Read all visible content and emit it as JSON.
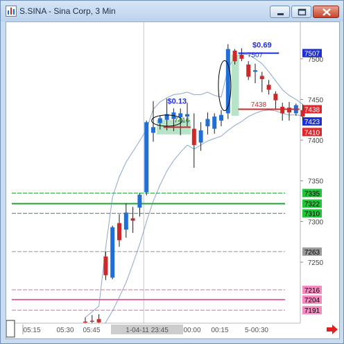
{
  "window": {
    "title": "S.SINA - Sina Corp, 3 Min",
    "buttons": {
      "minimize": "minimize",
      "maximize": "maximize",
      "close": "close"
    }
  },
  "colors": {
    "up": "#1f6fd6",
    "down": "#cc2a2a",
    "green_line": "#1aa72e",
    "pink_line": "#ee6aa6",
    "gray_line": "#9a9a9a",
    "band": "#6f8fc4",
    "fill_green": "#a9dfbf"
  },
  "chart_data": {
    "type": "candlestick",
    "symbol": "S.SINA",
    "interval": "3 Min",
    "ylim": [
      7175,
      7545
    ],
    "y_ticks": [
      "7500",
      "7450",
      "7400",
      "7350",
      "7300",
      "7250"
    ],
    "x_ticks": [
      "05:15",
      "05:30",
      "05:45",
      "1-04-11 23:45",
      "00:00",
      "00:15",
      "5-00:30"
    ],
    "x_current_label": "1-04-11 23:45",
    "candles": [
      {
        "o": 7177,
        "h": 7182,
        "l": 7170,
        "c": 7176
      },
      {
        "o": 7178,
        "h": 7185,
        "l": 7172,
        "c": 7177
      },
      {
        "o": 7180,
        "h": 7186,
        "l": 7174,
        "c": 7176
      },
      {
        "o": 7257,
        "h": 7263,
        "l": 7228,
        "c": 7234
      },
      {
        "o": 7231,
        "h": 7295,
        "l": 7229,
        "c": 7293
      },
      {
        "o": 7298,
        "h": 7309,
        "l": 7269,
        "c": 7277
      },
      {
        "o": 7290,
        "h": 7322,
        "l": 7280,
        "c": 7311
      },
      {
        "o": 7304,
        "h": 7318,
        "l": 7286,
        "c": 7301
      },
      {
        "o": 7317,
        "h": 7335,
        "l": 7306,
        "c": 7333
      },
      {
        "o": 7336,
        "h": 7424,
        "l": 7332,
        "c": 7422
      },
      {
        "o": 7409,
        "h": 7448,
        "l": 7398,
        "c": 7416
      },
      {
        "o": 7421,
        "h": 7430,
        "l": 7413,
        "c": 7427
      },
      {
        "o": 7425,
        "h": 7451,
        "l": 7412,
        "c": 7432
      },
      {
        "o": 7426,
        "h": 7439,
        "l": 7411,
        "c": 7434
      },
      {
        "o": 7428,
        "h": 7439,
        "l": 7406,
        "c": 7433
      },
      {
        "o": 7429,
        "h": 7446,
        "l": 7417,
        "c": 7432
      },
      {
        "o": 7414,
        "h": 7433,
        "l": 7366,
        "c": 7394
      },
      {
        "o": 7397,
        "h": 7422,
        "l": 7387,
        "c": 7412
      },
      {
        "o": 7417,
        "h": 7434,
        "l": 7407,
        "c": 7426
      },
      {
        "o": 7414,
        "h": 7433,
        "l": 7408,
        "c": 7429
      },
      {
        "o": 7424,
        "h": 7437,
        "l": 7417,
        "c": 7431
      },
      {
        "o": 7433,
        "h": 7518,
        "l": 7426,
        "c": 7512
      },
      {
        "o": 7510,
        "h": 7512,
        "l": 7493,
        "c": 7497
      },
      {
        "o": 7505,
        "h": 7513,
        "l": 7497,
        "c": 7500
      },
      {
        "o": 7493,
        "h": 7497,
        "l": 7474,
        "c": 7478
      },
      {
        "o": 7484,
        "h": 7494,
        "l": 7470,
        "c": 7486
      },
      {
        "o": 7479,
        "h": 7484,
        "l": 7459,
        "c": 7475
      },
      {
        "o": 7468,
        "h": 7474,
        "l": 7456,
        "c": 7462
      },
      {
        "o": 7457,
        "h": 7460,
        "l": 7438,
        "c": 7449
      },
      {
        "o": 7441,
        "h": 7446,
        "l": 7424,
        "c": 7433
      },
      {
        "o": 7440,
        "h": 7447,
        "l": 7424,
        "c": 7434
      },
      {
        "o": 7433,
        "h": 7445,
        "l": 7430,
        "c": 7443
      },
      {
        "o": 7437,
        "h": 7444,
        "l": 7424,
        "c": 7429
      }
    ],
    "horizontal_lines": [
      {
        "price": 7335,
        "style": "dashed",
        "color": "#1aa72e",
        "label": "7335",
        "badge": "#22c53a"
      },
      {
        "price": 7322,
        "style": "solid",
        "color": "#1aa72e",
        "label": "7322",
        "badge": "#22c53a"
      },
      {
        "price": 7310,
        "style": "dashed",
        "color": "#1aa72e",
        "label": "7310",
        "badge": "#22c53a"
      },
      {
        "price": 7263,
        "style": "dashed",
        "color": "#9a9a9a",
        "label": "7263",
        "badge": "#9a9a9a"
      },
      {
        "price": 7216,
        "style": "dashed",
        "color": "#ee6aa6",
        "label": "7216",
        "badge": "#f48cc0"
      },
      {
        "price": 7204,
        "style": "solid",
        "color": "#ee6aa6",
        "label": "7204",
        "badge": "#f48cc0"
      },
      {
        "price": 7191,
        "style": "dashed",
        "color": "#ee6aa6",
        "label": "7191",
        "badge": "#f48cc0"
      }
    ],
    "price_badges": [
      {
        "price": 7507,
        "label": "7507",
        "color": "#1f2fd6"
      },
      {
        "price": 7438,
        "label": "7438",
        "color": "#e0262a"
      },
      {
        "price": 7423,
        "label": "7423",
        "color": "#1f2fd6"
      },
      {
        "price": 7410,
        "label": "7410",
        "color": "#e0262a"
      }
    ],
    "annotations": [
      {
        "text": "$0.13",
        "value_line": 7416,
        "label": "7416"
      },
      {
        "text": "$0.69",
        "value_line": 7507,
        "label": "7507"
      },
      {
        "text": "",
        "value_line": 7438,
        "label": "7438"
      }
    ],
    "upper_band": [
      7182,
      7189,
      7196,
      7268,
      7330,
      7355,
      7373,
      7386,
      7399,
      7413,
      7438,
      7447,
      7452,
      7456,
      7457,
      7459,
      7456,
      7456,
      7459,
      7455,
      7453,
      7488,
      7503,
      7506,
      7505,
      7500,
      7494,
      7484,
      7473,
      7462,
      7455,
      7450,
      7444
    ],
    "lower_band": [
      7166,
      7167,
      7169,
      7176,
      7190,
      7207,
      7225,
      7248,
      7272,
      7300,
      7325,
      7345,
      7362,
      7375,
      7385,
      7394,
      7389,
      7394,
      7399,
      7402,
      7405,
      7412,
      7418,
      7423,
      7429,
      7433,
      7436,
      7437,
      7436,
      7433,
      7431,
      7431,
      7430
    ]
  }
}
